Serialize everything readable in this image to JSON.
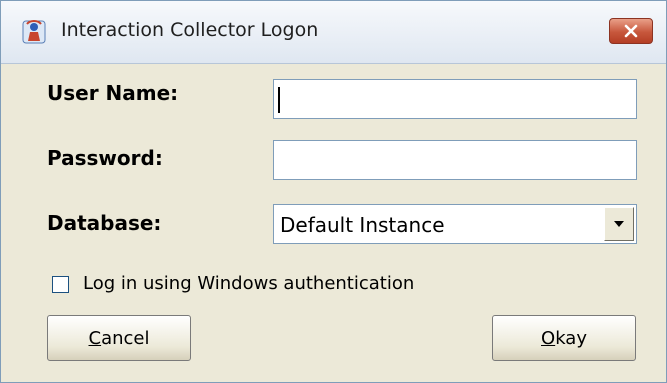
{
  "window": {
    "title": "Interaction Collector Logon",
    "app_icon": "collector-app-icon",
    "close_icon": "close-icon"
  },
  "form": {
    "username": {
      "label": "User Name:",
      "value": ""
    },
    "password": {
      "label": "Password:",
      "value": ""
    },
    "database": {
      "label": "Database:",
      "selected": "Default Instance",
      "arrow_icon": "chevron-down-icon"
    },
    "windows_auth": {
      "label": "Log in using Windows authentication",
      "checked": false
    }
  },
  "buttons": {
    "cancel": {
      "mnemonic": "C",
      "rest": "ancel"
    },
    "okay": {
      "mnemonic": "O",
      "rest": "kay"
    }
  },
  "colors": {
    "close_button": "#c7573c",
    "border": "#7f9db9",
    "dialog_background": "#ece9d8"
  }
}
